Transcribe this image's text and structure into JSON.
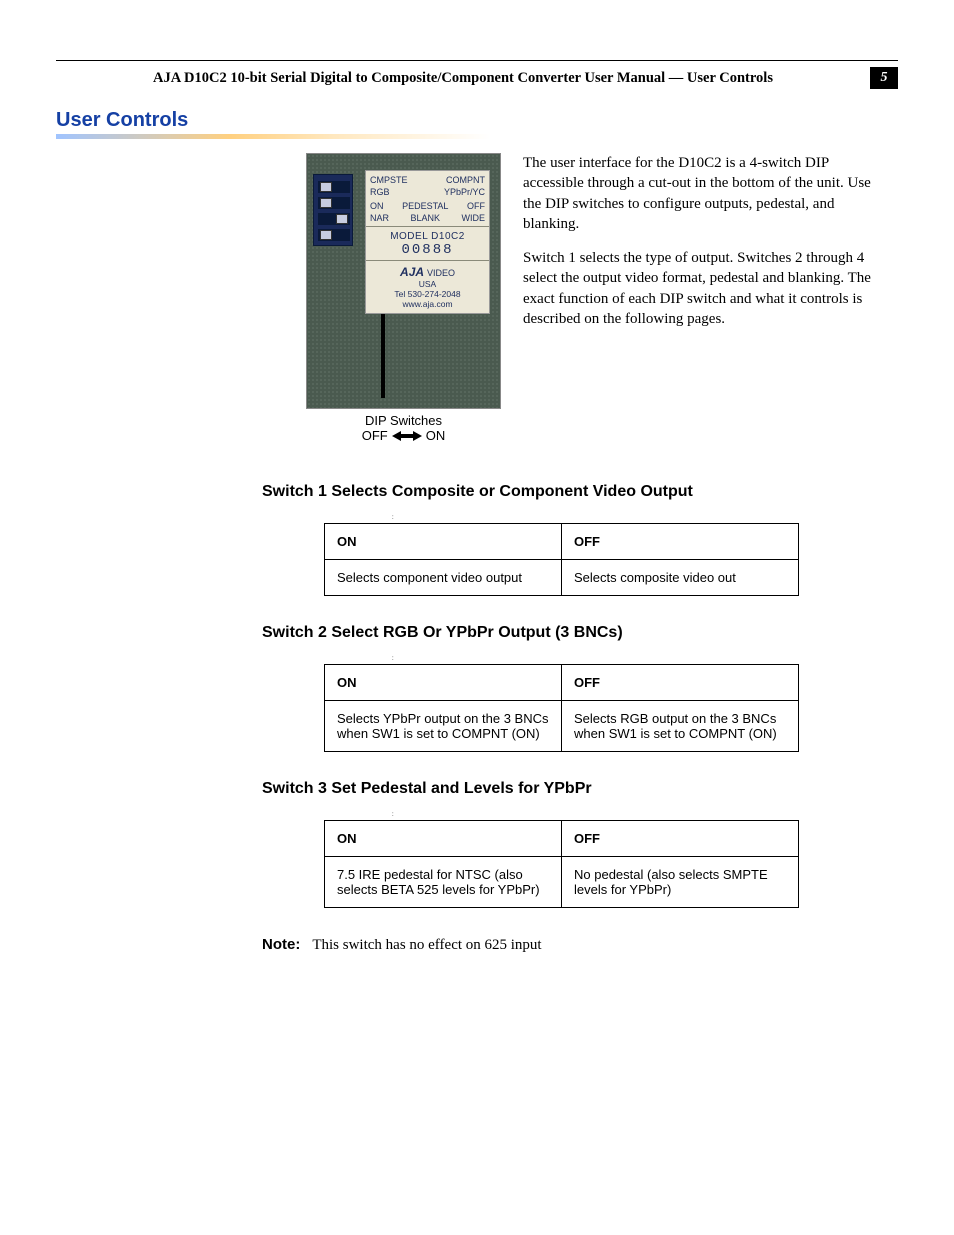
{
  "header": {
    "running_title": "AJA D10C2 10-bit Serial Digital to Composite/Component Converter User Manual — User Controls",
    "page_number": "5"
  },
  "section_title": "User Controls",
  "dip_label": {
    "rows": [
      [
        "CMPSTE",
        "COMPNT"
      ],
      [
        "RGB",
        "YPbPr/YC"
      ]
    ],
    "row3": [
      "ON",
      "PEDESTAL",
      "OFF"
    ],
    "row4": [
      "NAR",
      "BLANK",
      "WIDE"
    ],
    "model": "MODEL D10C2",
    "serial": "00888",
    "brand": "AJA",
    "brand_suffix": "VIDEO",
    "country": "USA",
    "tel": "Tel 530-274-2048",
    "url": "www.aja.com"
  },
  "figure_caption_1": "DIP Switches",
  "figure_caption_off": "OFF",
  "figure_caption_on": "ON",
  "intro_paragraphs": [
    "The user interface for the D10C2 is a 4-switch DIP accessible through a cut-out in the bottom of the unit. Use the DIP switches to configure outputs, pedestal, and blanking.",
    "Switch 1 selects the type of output. Switches 2 through 4 select the output video format, pedestal and blanking. The exact function of each DIP switch and what it controls is described on the following pages."
  ],
  "switches": [
    {
      "title": "Switch 1 Selects Composite or Component Video Output",
      "on_header": "ON",
      "off_header": "OFF",
      "on_text": "Selects component video output",
      "off_text": "Selects composite video out"
    },
    {
      "title": "Switch 2 Select RGB Or YPbPr Output (3 BNCs)",
      "on_header": "ON",
      "off_header": "OFF",
      "on_text": "Selects YPbPr output on the 3 BNCs when SW1 is set to COMPNT (ON)",
      "off_text": "Selects RGB output on the 3 BNCs when SW1 is set to COMPNT (ON)"
    },
    {
      "title": "Switch 3 Set Pedestal and Levels for YPbPr",
      "on_header": "ON",
      "off_header": "OFF",
      "on_text": "7.5 IRE pedestal for NTSC (also selects BETA 525 levels for YPbPr)",
      "off_text": "No pedestal (also selects SMPTE levels for YPbPr)"
    }
  ],
  "note_label": "Note:",
  "note_text": "This switch has no effect on 625 input"
}
